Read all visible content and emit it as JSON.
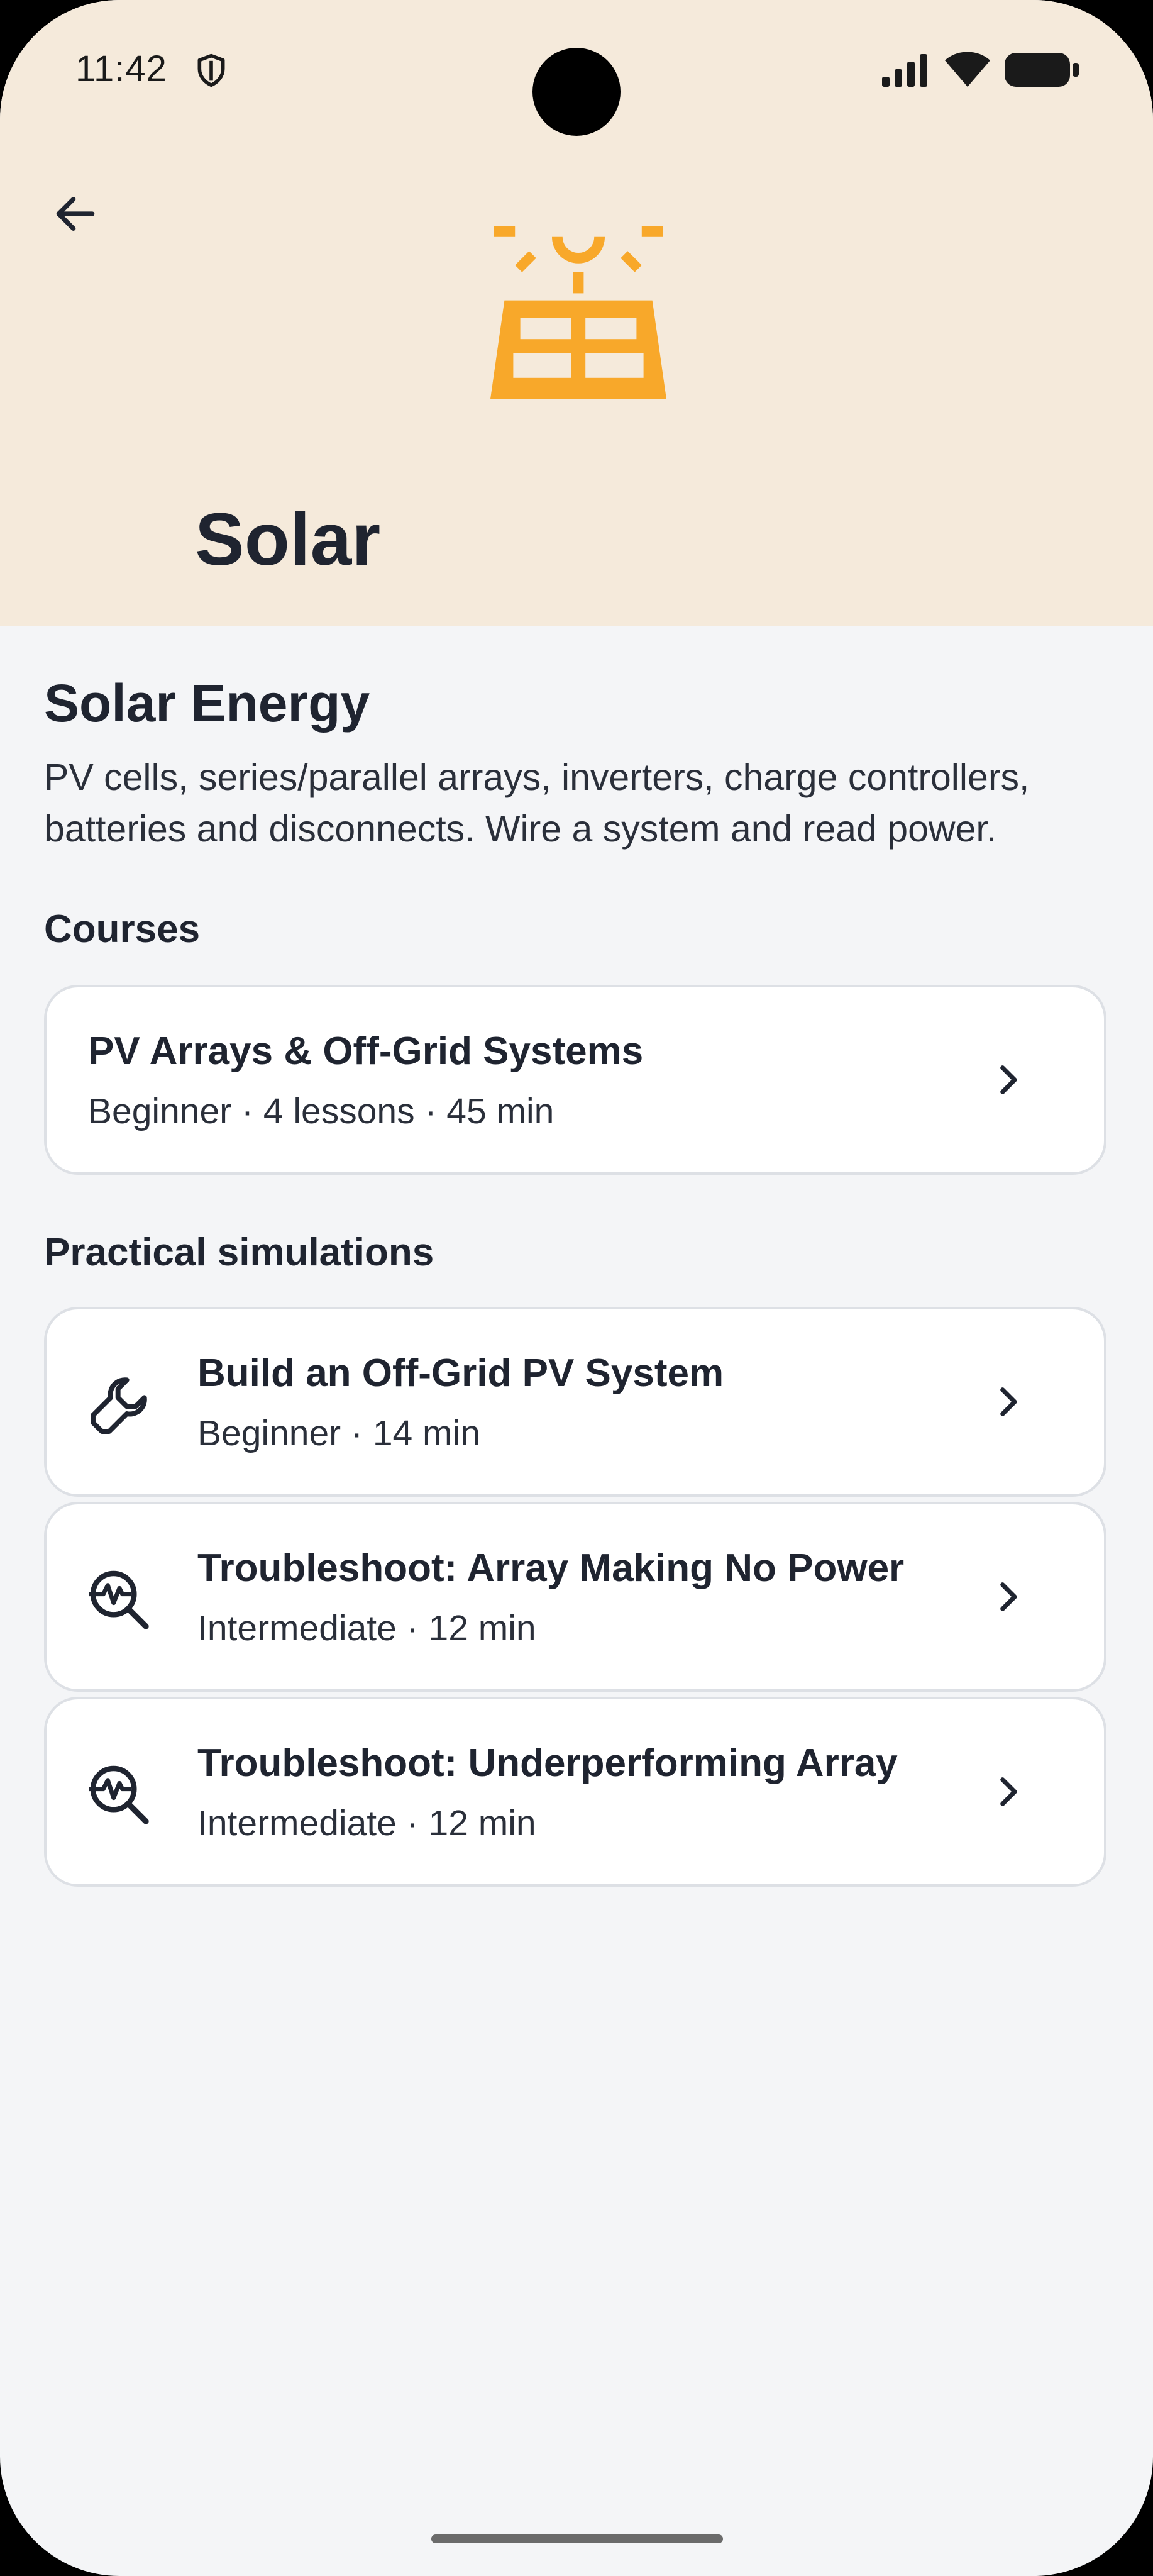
{
  "status_bar": {
    "time": "11:42"
  },
  "header": {
    "title": "Solar",
    "icon": "solar-panel-icon",
    "accent_color": "#f8a82a",
    "background_color": "#f5eadb"
  },
  "topic": {
    "title": "Solar Energy",
    "description": "PV cells, series/parallel arrays, inverters, charge controllers, batteries and disconnects. Wire a system and read power."
  },
  "courses": {
    "label": "Courses",
    "items": [
      {
        "title": "PV Arrays & Off-Grid Systems",
        "meta": "Beginner · 4 lessons · 45 min"
      }
    ]
  },
  "simulations": {
    "label": "Practical simulations",
    "items": [
      {
        "title": "Build an Off-Grid PV System",
        "meta": "Beginner · 14 min",
        "icon": "wrench-icon"
      },
      {
        "title": "Troubleshoot: Array Making No Power",
        "meta": "Intermediate · 12 min",
        "icon": "magnify-waveform-icon"
      },
      {
        "title": "Troubleshoot: Underperforming Array",
        "meta": "Intermediate · 12 min",
        "icon": "magnify-waveform-icon"
      }
    ]
  }
}
